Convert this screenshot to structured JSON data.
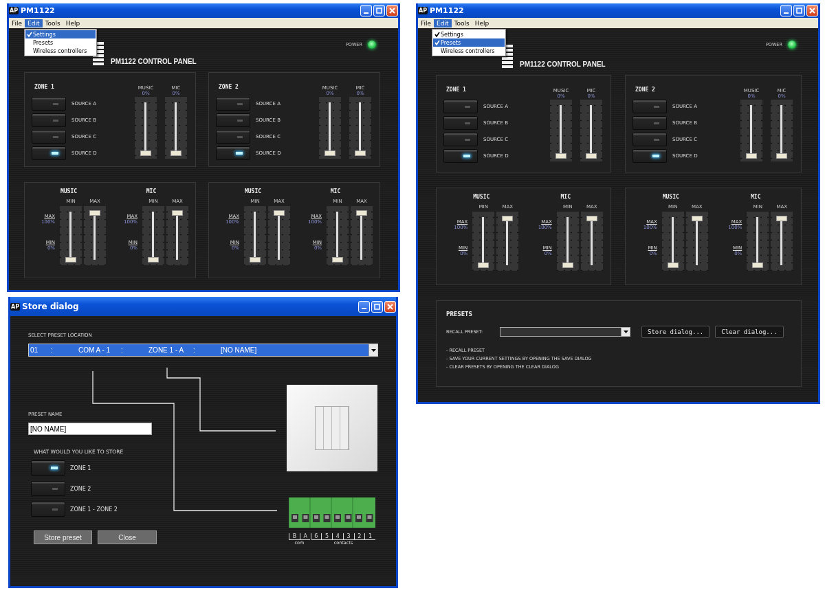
{
  "windows": [
    {
      "kind": "panel",
      "icon_text": "AP",
      "title": "PM1122",
      "menu": [
        {
          "label": "File",
          "selected": false
        },
        {
          "label": "Edit",
          "selected": true
        },
        {
          "label": "Tools",
          "selected": false
        },
        {
          "label": "Help",
          "selected": false
        }
      ],
      "dropdown": [
        {
          "label": "Settings",
          "checked": true,
          "selected": true
        },
        {
          "label": "Presets",
          "checked": false,
          "selected": false
        },
        {
          "label": "Wireless controllers",
          "checked": false,
          "selected": false
        }
      ],
      "heading": "PM1122 CONTROL PANEL",
      "power": {
        "label": "POWER",
        "on": true
      },
      "zones": [
        {
          "title": "ZONE 1",
          "sources": [
            {
              "label": "SOURCE A",
              "on": false
            },
            {
              "label": "SOURCE B",
              "on": false
            },
            {
              "label": "SOURCE C",
              "on": false
            },
            {
              "label": "SOURCE D",
              "on": true
            }
          ],
          "faders": [
            {
              "label": "MUSIC",
              "reading": "0%",
              "level": 0
            },
            {
              "label": "MIC",
              "reading": "0%",
              "level": 0
            }
          ]
        },
        {
          "title": "ZONE 2",
          "sources": [
            {
              "label": "SOURCE A",
              "on": false
            },
            {
              "label": "SOURCE B",
              "on": false
            },
            {
              "label": "SOURCE C",
              "on": false
            },
            {
              "label": "SOURCE D",
              "on": true
            }
          ],
          "faders": [
            {
              "label": "MUSIC",
              "reading": "0%",
              "level": 0
            },
            {
              "label": "MIC",
              "reading": "0%",
              "level": 0
            }
          ]
        }
      ],
      "ranges": [
        {
          "groups": [
            {
              "title": "MUSIC",
              "max_link": "MAX",
              "max_reading": "100%",
              "min_link": "MIN",
              "min_reading": "0%",
              "sliders": [
                {
                  "label": "MIN",
                  "level": 0
                },
                {
                  "label": "MAX",
                  "level": 1
                }
              ]
            },
            {
              "title": "MIC",
              "max_link": "MAX",
              "max_reading": "100%",
              "min_link": "MIN",
              "min_reading": "0%",
              "sliders": [
                {
                  "label": "MIN",
                  "level": 0
                },
                {
                  "label": "MAX",
                  "level": 1
                }
              ]
            }
          ]
        },
        {
          "groups": [
            {
              "title": "MUSIC",
              "max_link": "MAX",
              "max_reading": "100%",
              "min_link": "MIN",
              "min_reading": "0%",
              "sliders": [
                {
                  "label": "MIN",
                  "level": 0
                },
                {
                  "label": "MAX",
                  "level": 1
                }
              ]
            },
            {
              "title": "MIC",
              "max_link": "MAX",
              "max_reading": "100%",
              "min_link": "MIN",
              "min_reading": "0%",
              "sliders": [
                {
                  "label": "MIN",
                  "level": 0
                },
                {
                  "label": "MAX",
                  "level": 1
                }
              ]
            }
          ]
        }
      ]
    },
    {
      "kind": "panel",
      "icon_text": "AP",
      "title": "PM1122",
      "menu": [
        {
          "label": "File",
          "selected": false
        },
        {
          "label": "Edit",
          "selected": true
        },
        {
          "label": "Tools",
          "selected": false
        },
        {
          "label": "Help",
          "selected": false
        }
      ],
      "dropdown": [
        {
          "label": "Settings",
          "checked": true,
          "selected": false
        },
        {
          "label": "Presets",
          "checked": true,
          "selected": true
        },
        {
          "label": "Wireless controllers",
          "checked": false,
          "selected": false
        }
      ],
      "heading": "PM1122 CONTROL PANEL",
      "power": {
        "label": "POWER",
        "on": true
      },
      "zones": [
        {
          "title": "ZONE 1",
          "sources": [
            {
              "label": "SOURCE A",
              "on": false
            },
            {
              "label": "SOURCE B",
              "on": false
            },
            {
              "label": "SOURCE C",
              "on": false
            },
            {
              "label": "SOURCE D",
              "on": true
            }
          ],
          "faders": [
            {
              "label": "MUSIC",
              "reading": "0%",
              "level": 0
            },
            {
              "label": "MIC",
              "reading": "0%",
              "level": 0
            }
          ]
        },
        {
          "title": "ZONE 2",
          "sources": [
            {
              "label": "SOURCE A",
              "on": false
            },
            {
              "label": "SOURCE B",
              "on": false
            },
            {
              "label": "SOURCE C",
              "on": false
            },
            {
              "label": "SOURCE D",
              "on": true
            }
          ],
          "faders": [
            {
              "label": "MUSIC",
              "reading": "0%",
              "level": 0
            },
            {
              "label": "MIC",
              "reading": "0%",
              "level": 0
            }
          ]
        }
      ],
      "ranges": [
        {
          "groups": [
            {
              "title": "MUSIC",
              "max_link": "MAX",
              "max_reading": "100%",
              "min_link": "MIN",
              "min_reading": "0%",
              "sliders": [
                {
                  "label": "MIN",
                  "level": 0
                },
                {
                  "label": "MAX",
                  "level": 1
                }
              ]
            },
            {
              "title": "MIC",
              "max_link": "MAX",
              "max_reading": "100%",
              "min_link": "MIN",
              "min_reading": "0%",
              "sliders": [
                {
                  "label": "MIN",
                  "level": 0
                },
                {
                  "label": "MAX",
                  "level": 1
                }
              ]
            }
          ]
        },
        {
          "groups": [
            {
              "title": "MUSIC",
              "max_link": "MAX",
              "max_reading": "100%",
              "min_link": "MIN",
              "min_reading": "0%",
              "sliders": [
                {
                  "label": "MIN",
                  "level": 0
                },
                {
                  "label": "MAX",
                  "level": 1
                }
              ]
            },
            {
              "title": "MIC",
              "max_link": "MAX",
              "max_reading": "100%",
              "min_link": "MIN",
              "min_reading": "0%",
              "sliders": [
                {
                  "label": "MIN",
                  "level": 0
                },
                {
                  "label": "MAX",
                  "level": 1
                }
              ]
            }
          ]
        }
      ],
      "presets": {
        "title": "PRESETS",
        "recall_label": "RECALL PRESET:",
        "buttons": [
          "Store dialog...",
          "Clear dialog..."
        ],
        "notes": [
          "- RECALL PRESET",
          "- SAVE YOUR CURRENT SETTINGS BY OPENING THE SAVE DIALOG",
          "- CLEAR PRESETS BY OPENING THE CLEAR DIALOG"
        ]
      }
    },
    {
      "kind": "dialog",
      "icon_text": "AP",
      "title": "Store dialog",
      "location_label": "SELECT PRESET LOCATION",
      "location_parts": [
        "01",
        ":",
        "COM A - 1",
        ":",
        "ZONE 1 - A",
        ":",
        "[NO NAME]"
      ],
      "name_label": "PRESET NAME",
      "name_value": "[NO NAME]",
      "store_label": "WHAT WOULD YOU LIKE TO STORE",
      "options": [
        {
          "label": "ZONE 1",
          "selected": true
        },
        {
          "label": "ZONE 2",
          "selected": false
        },
        {
          "label": "ZONE 1 - ZONE 2",
          "selected": false
        }
      ],
      "buttons": [
        "Store preset",
        "Close"
      ],
      "terminals": [
        "B",
        "A",
        "6",
        "5",
        "4",
        "3",
        "2",
        "1"
      ],
      "terminal_groups": [
        "com",
        "contacts"
      ]
    }
  ]
}
